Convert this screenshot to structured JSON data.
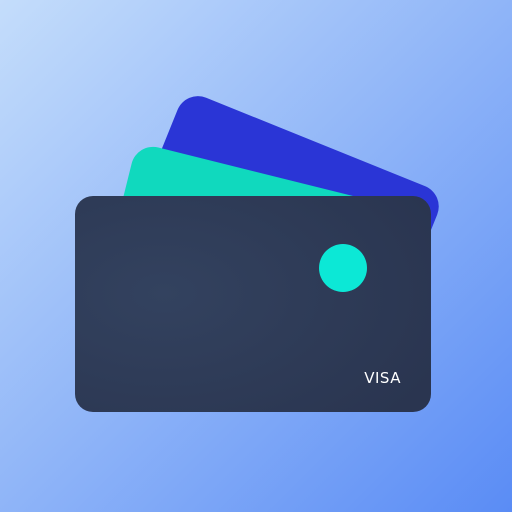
{
  "icon": {
    "semantic": "wallet-cards-icon",
    "colors": {
      "background_top_left": "#c4ddfb",
      "background_bottom_right": "#5a8cf5",
      "back_card": "#2a35d6",
      "middle_card": "#10d9be",
      "front_card": "#33425f",
      "front_card_dark": "#2a3550",
      "chip": "#0ce8d6",
      "label": "#ffffff"
    },
    "brand_label": "VISA"
  }
}
